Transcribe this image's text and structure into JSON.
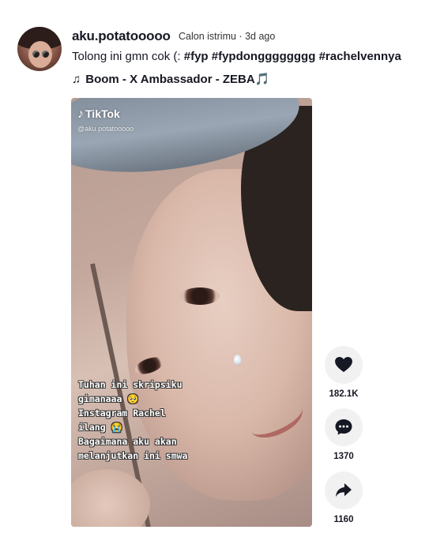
{
  "post": {
    "username": "aku.potatooooo",
    "nickname": "Calon istrimu",
    "separator": "·",
    "posted": "3d ago",
    "caption_text": "Tolong ini gmn cok (: ",
    "hashtags": [
      "#fyp",
      "#fypdongggggggg",
      "#rachelvennya"
    ],
    "music_icon": "♫",
    "music": "Boom - X Ambassador - ZEBA🎵"
  },
  "video": {
    "watermark_logo": "TikTok",
    "watermark_handle": "@aku.potatooooo",
    "overlay_lines": [
      "Tuhan ini skripsiku",
      "gimanaaa 🥺",
      "Instagram Rachel",
      "ilang 😭",
      "Bagaimana aku akan",
      "melanjutkan ini smwa"
    ]
  },
  "actions": {
    "like_icon": "heart-icon",
    "like_count": "182.1K",
    "comment_icon": "comment-icon",
    "comment_count": "1370",
    "share_icon": "share-icon",
    "share_count": "1160"
  }
}
